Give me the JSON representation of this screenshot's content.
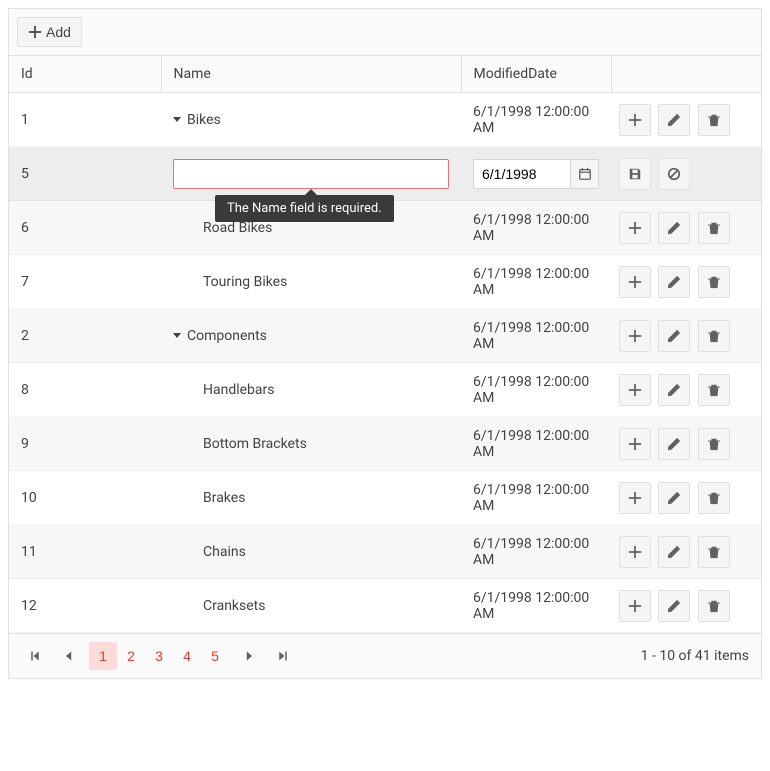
{
  "toolbar": {
    "add_label": "Add"
  },
  "columns": {
    "id": "Id",
    "name": "Name",
    "modified": "ModifiedDate"
  },
  "edit_row": {
    "id": "5",
    "name_value": "",
    "date_value": "6/1/1998",
    "validation_msg": "The Name field is required."
  },
  "rows": [
    {
      "id": "1",
      "name": "Bikes",
      "modified": "6/1/1998 12:00:00 AM",
      "level": 0,
      "expandable": true
    },
    {
      "id": "6",
      "name": "Road Bikes",
      "modified": "6/1/1998 12:00:00 AM",
      "level": 1,
      "expandable": false
    },
    {
      "id": "7",
      "name": "Touring Bikes",
      "modified": "6/1/1998 12:00:00 AM",
      "level": 1,
      "expandable": false
    },
    {
      "id": "2",
      "name": "Components",
      "modified": "6/1/1998 12:00:00 AM",
      "level": 0,
      "expandable": true
    },
    {
      "id": "8",
      "name": "Handlebars",
      "modified": "6/1/1998 12:00:00 AM",
      "level": 1,
      "expandable": false
    },
    {
      "id": "9",
      "name": "Bottom Brackets",
      "modified": "6/1/1998 12:00:00 AM",
      "level": 1,
      "expandable": false
    },
    {
      "id": "10",
      "name": "Brakes",
      "modified": "6/1/1998 12:00:00 AM",
      "level": 1,
      "expandable": false
    },
    {
      "id": "11",
      "name": "Chains",
      "modified": "6/1/1998 12:00:00 AM",
      "level": 1,
      "expandable": false
    },
    {
      "id": "12",
      "name": "Cranksets",
      "modified": "6/1/1998 12:00:00 AM",
      "level": 1,
      "expandable": false
    }
  ],
  "pager": {
    "pages": [
      "1",
      "2",
      "3",
      "4",
      "5"
    ],
    "active_page": "1",
    "summary": "1 - 10 of 41 items"
  }
}
